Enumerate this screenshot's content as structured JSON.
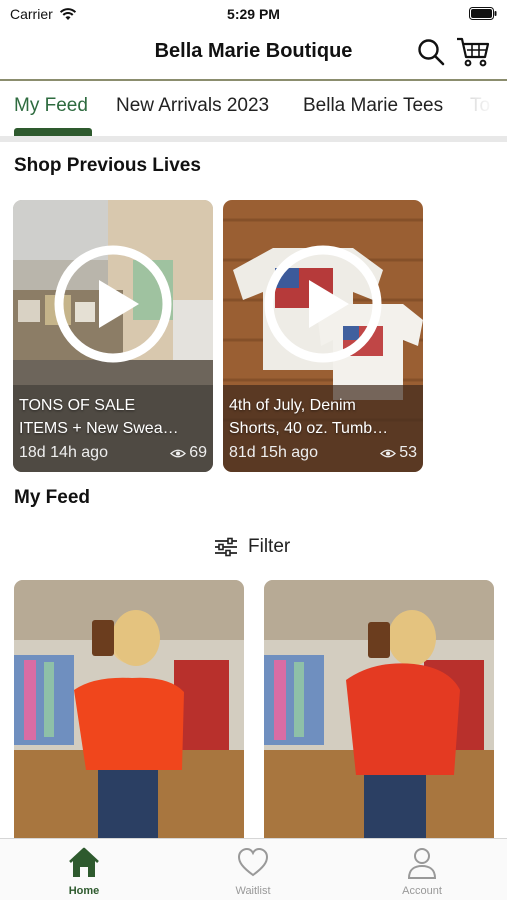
{
  "status_bar": {
    "carrier": "Carrier",
    "time": "5:29 PM"
  },
  "header": {
    "title": "Bella Marie Boutique"
  },
  "tabs": [
    {
      "label": "My Feed",
      "active": true
    },
    {
      "label": "New Arrivals 2023",
      "active": false
    },
    {
      "label": "Bella Marie Tees",
      "active": false
    },
    {
      "label": "To",
      "active": false
    }
  ],
  "previous_lives": {
    "title": "Shop Previous Lives",
    "items": [
      {
        "title": "TONS OF SALE\nITEMS + New Swea…",
        "time_ago": "18d 14h ago",
        "views": "69"
      },
      {
        "title": "4th of July, Denim\nShorts, 40 oz. Tumb…",
        "time_ago": "81d 15h ago",
        "views": "53"
      }
    ]
  },
  "feed": {
    "title": "My Feed",
    "filter_label": "Filter"
  },
  "bottom_nav": [
    {
      "label": "Home",
      "icon": "home-icon",
      "active": true
    },
    {
      "label": "Waitlist",
      "icon": "heart-icon",
      "active": false
    },
    {
      "label": "Account",
      "icon": "person-icon",
      "active": false
    }
  ],
  "colors": {
    "accent": "#2e5a2e",
    "header_rule": "#8b8d6e",
    "inactive_nav": "#999999"
  }
}
